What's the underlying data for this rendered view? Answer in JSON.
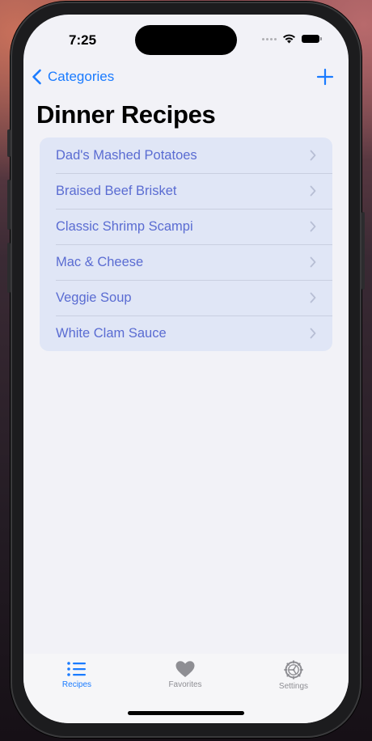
{
  "status_bar": {
    "time": "7:25"
  },
  "nav": {
    "back_label": "Categories",
    "back_icon": "chevron-left-icon",
    "add_icon": "plus-icon"
  },
  "page": {
    "title": "Dinner Recipes"
  },
  "recipes": [
    {
      "label": "Dad's Mashed Potatoes"
    },
    {
      "label": "Braised Beef Brisket"
    },
    {
      "label": "Classic Shrimp Scampi"
    },
    {
      "label": "Mac & Cheese"
    },
    {
      "label": "Veggie Soup"
    },
    {
      "label": "White Clam Sauce"
    }
  ],
  "tabs": [
    {
      "label": "Recipes",
      "icon": "list-icon",
      "selected": true
    },
    {
      "label": "Favorites",
      "icon": "heart-icon",
      "selected": false
    },
    {
      "label": "Settings",
      "icon": "gear-icon",
      "selected": false
    }
  ],
  "colors": {
    "accent": "#1a7bff",
    "row_background": "#e0e6f6",
    "row_text": "#5a6cd2",
    "tab_inactive": "#8e8e93",
    "screen_background": "#f2f2f7"
  }
}
